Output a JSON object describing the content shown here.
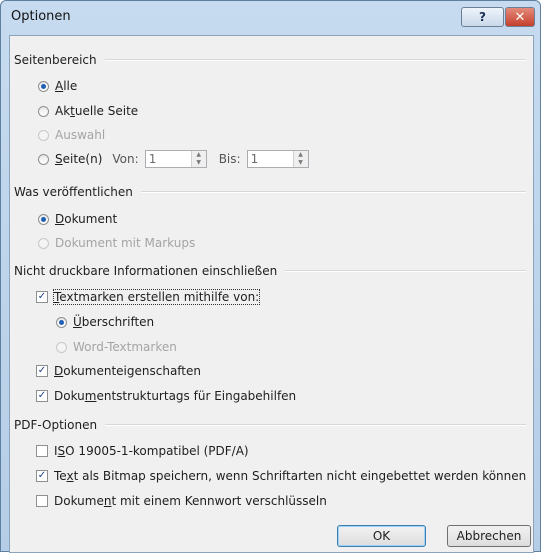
{
  "window": {
    "title": "Optionen",
    "help_glyph": "?",
    "close_glyph": "✕"
  },
  "seitenbereich": {
    "heading": "Seitenbereich",
    "alle": {
      "pre": "",
      "ul": "A",
      "post": "lle"
    },
    "aktuelle": {
      "pre": "Ak",
      "ul": "t",
      "post": "uelle Seite"
    },
    "auswahl": "Auswahl",
    "seiten": {
      "pre": "",
      "ul": "S",
      "post": "eite(n)"
    },
    "von_label": "Von:",
    "von_value": "1",
    "bis_label": "Bis:",
    "bis_value": "1"
  },
  "veroeffentlichen": {
    "heading": "Was veröffentlichen",
    "dokument": {
      "pre": "",
      "ul": "D",
      "post": "okument"
    },
    "markups": "Dokument mit Markups"
  },
  "nicht_druckbar": {
    "heading": "Nicht druckbare Informationen einschließen",
    "textmarken": {
      "pre": "",
      "ul": "T",
      "post": "extmarken erstellen mithilfe von:"
    },
    "ueberschriften": {
      "pre": "",
      "ul": "Ü",
      "post": "berschriften"
    },
    "word_textmarken": "Word-Textmarken",
    "eigenschaften": {
      "pre": "",
      "ul": "D",
      "post": "okumenteigenschaften"
    },
    "strukturtags": {
      "pre": "Doku",
      "ul": "m",
      "post": "entstrukturtags für Eingabehilfen"
    }
  },
  "pdf": {
    "heading": "PDF-Optionen",
    "iso": {
      "pre": "I",
      "ul": "S",
      "post": "O 19005-1-kompatibel (PDF/A)"
    },
    "bitmap": {
      "pre": "Te",
      "ul": "x",
      "post": "t als Bitmap speichern, wenn Schriftarten nicht eingebettet werden können"
    },
    "kennwort": {
      "pre": "Dokume",
      "ul": "n",
      "post": "t mit einem Kennwort verschlüsseln"
    }
  },
  "buttons": {
    "ok": "OK",
    "cancel": "Abbrechen"
  },
  "check_glyph": "✓"
}
